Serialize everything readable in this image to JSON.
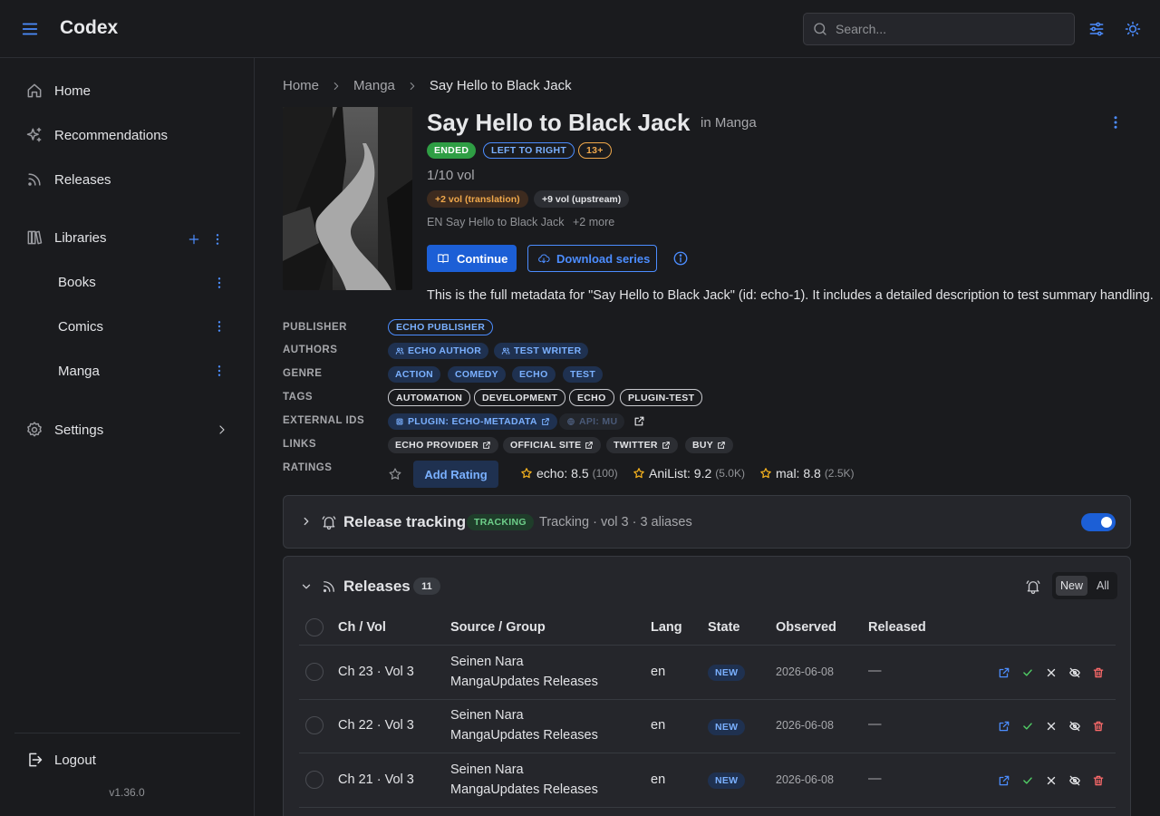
{
  "header": {
    "app_title": "Codex",
    "search_placeholder": "Search..."
  },
  "sidebar": {
    "home": "Home",
    "recommendations": "Recommendations",
    "releases": "Releases",
    "libraries": "Libraries",
    "library_items": [
      "Books",
      "Comics",
      "Manga"
    ],
    "settings": "Settings",
    "logout": "Logout",
    "version": "v1.36.0"
  },
  "breadcrumb": [
    "Home",
    "Manga",
    "Say Hello to Black Jack"
  ],
  "series": {
    "title": "Say Hello to Black Jack",
    "in_library": "in Manga",
    "badges": [
      "ENDED",
      "LEFT TO RIGHT",
      "13+"
    ],
    "volumes": "1/10 vol",
    "vol_pills": [
      "+2 vol (translation)",
      "+9 vol (upstream)"
    ],
    "alt_title": "EN Say Hello to Black Jack",
    "alt_more": "+2 more",
    "continue_label": "Continue",
    "download_label": "Download series",
    "summary": "This is the full metadata for \"Say Hello to Black Jack\" (id: echo-1). It includes a detailed description to test summary handling."
  },
  "metadata": {
    "labels": {
      "publisher": "PUBLISHER",
      "authors": "AUTHORS",
      "genre": "GENRE",
      "tags": "TAGS",
      "external_ids": "EXTERNAL IDS",
      "links": "LINKS",
      "ratings": "RATINGS"
    },
    "publisher": [
      "ECHO PUBLISHER"
    ],
    "authors": [
      "ECHO AUTHOR",
      "TEST WRITER"
    ],
    "genre": [
      "ACTION",
      "COMEDY",
      "ECHO",
      "TEST"
    ],
    "tags": [
      "AUTOMATION",
      "DEVELOPMENT",
      "ECHO",
      "PLUGIN-TEST"
    ],
    "external_ids": [
      "PLUGIN: ECHO-METADATA",
      "API: MU"
    ],
    "links": [
      "ECHO PROVIDER",
      "OFFICIAL SITE",
      "TWITTER",
      "BUY"
    ],
    "add_rating_label": "Add Rating",
    "ratings": [
      {
        "source": "echo: 8.5",
        "count": "(100)"
      },
      {
        "source": "AniList: 9.2",
        "count": "(5.0K)"
      },
      {
        "source": "mal: 8.8",
        "count": "(2.5K)"
      }
    ]
  },
  "release_tracking": {
    "title": "Release tracking",
    "badge": "TRACKING",
    "status": "Tracking · vol 3 · 3 aliases",
    "enabled": true
  },
  "releases": {
    "title": "Releases",
    "count": "11",
    "filter_options": [
      "New",
      "All"
    ],
    "selected_filter": "New",
    "columns": [
      "Ch / Vol",
      "Source / Group",
      "Lang",
      "State",
      "Observed",
      "Released"
    ],
    "rows": [
      {
        "chvol": "Ch 23 · Vol 3",
        "source": "Seinen Nara",
        "group": "MangaUpdates Releases",
        "lang": "en",
        "state": "NEW",
        "observed": "2026-06-08",
        "released": "—"
      },
      {
        "chvol": "Ch 22 · Vol 3",
        "source": "Seinen Nara",
        "group": "MangaUpdates Releases",
        "lang": "en",
        "state": "NEW",
        "observed": "2026-06-08",
        "released": "—"
      },
      {
        "chvol": "Ch 21 · Vol 3",
        "source": "Seinen Nara",
        "group": "MangaUpdates Releases",
        "lang": "en",
        "state": "NEW",
        "observed": "2026-06-08",
        "released": "—"
      }
    ]
  },
  "colors": {
    "accent": "#4c8dff",
    "primary_button": "#1c5fd6",
    "ended_badge": "#2f9e44",
    "age_badge": "#f0a84b",
    "success": "#51cf66",
    "danger": "#ff6b6b",
    "star": "#f2b01e"
  }
}
